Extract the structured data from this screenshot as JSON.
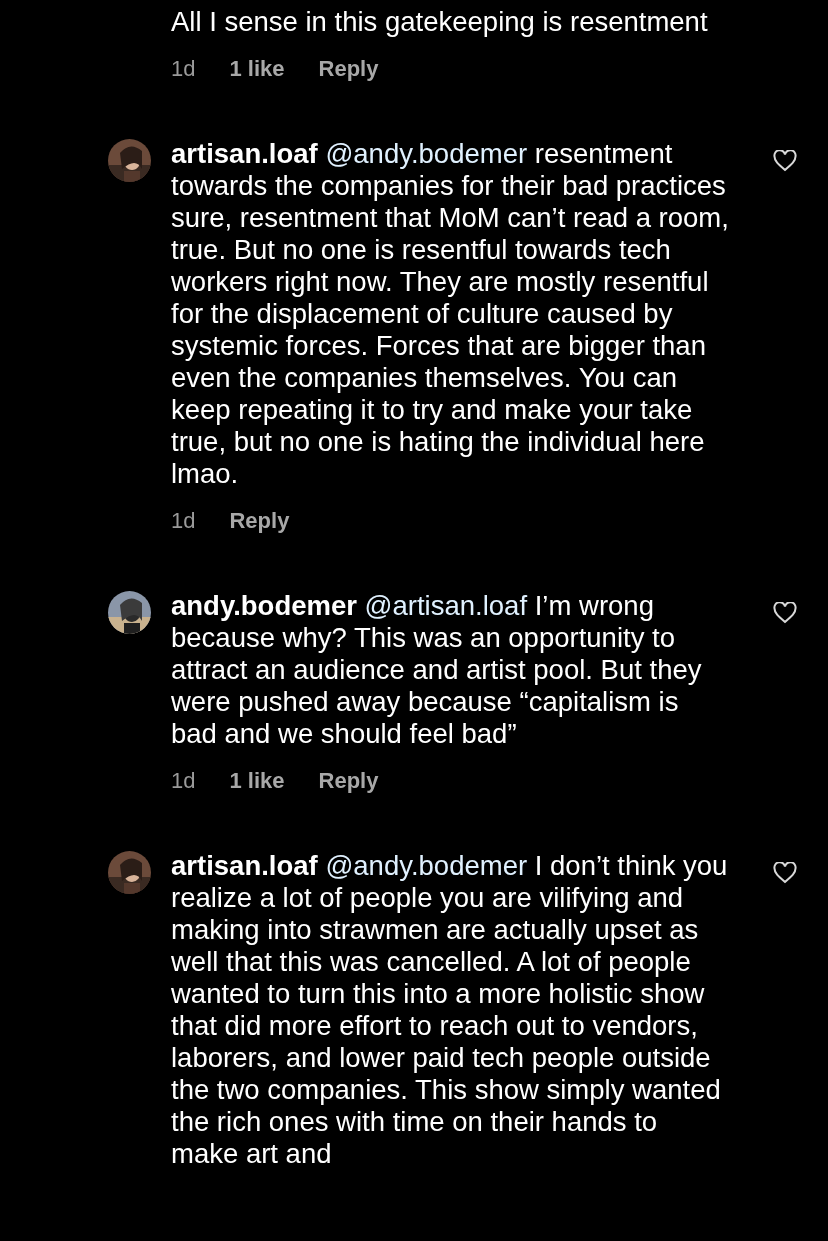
{
  "comments": [
    {
      "text": "All I sense in this gatekeeping is resentment",
      "time": "1d",
      "likes": "1 like",
      "reply": "Reply"
    },
    {
      "username": "artisan.loaf",
      "mention": "@andy.bodemer",
      "text": "resentment towards the companies for their bad practices sure, resentment that MoM can’t read a room, true. But no one is resentful towards tech workers right now. They are mostly resentful for the displacement of culture caused by systemic forces. Forces that are bigger than even the companies themselves. You can keep repeating it to try and make your take true, but no one is hating the individual here lmao.",
      "time": "1d",
      "reply": "Reply",
      "liked": false
    },
    {
      "username": "andy.bodemer",
      "mention": "@artisan.loaf",
      "text": "I’m wrong because why? This was an opportunity to attract an audience and artist pool. But they were pushed away because “capitalism is bad and we should feel bad”",
      "time": "1d",
      "likes": "1 like",
      "reply": "Reply",
      "liked": false
    },
    {
      "username": "artisan.loaf",
      "mention": "@andy.bodemer",
      "text": "I don’t think you realize a lot of people you are vilifying and making into strawmen are actually upset as well that this was cancelled. A lot of people wanted to turn this into a more holistic show that did more effort to reach out to vendors, laborers, and lower paid tech people outside the two companies. This show simply wanted the rich ones with time on their hands to make art and",
      "liked": false
    }
  ]
}
